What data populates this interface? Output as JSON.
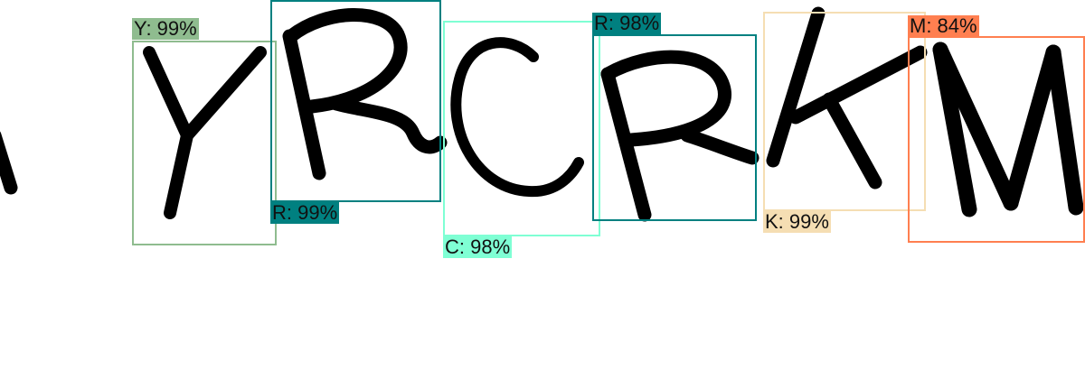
{
  "detections": [
    {
      "label": "Y: 99%",
      "color": "#8fbc8f"
    },
    {
      "label": "R: 99%",
      "color": "#008080"
    },
    {
      "label": "C: 98%",
      "color": "#7fffd4"
    },
    {
      "label": "R: 98%",
      "color": "#008080"
    },
    {
      "label": "K: 99%",
      "color": "#f5deb3"
    },
    {
      "label": "M: 84%",
      "color": "#ff7f50"
    }
  ]
}
